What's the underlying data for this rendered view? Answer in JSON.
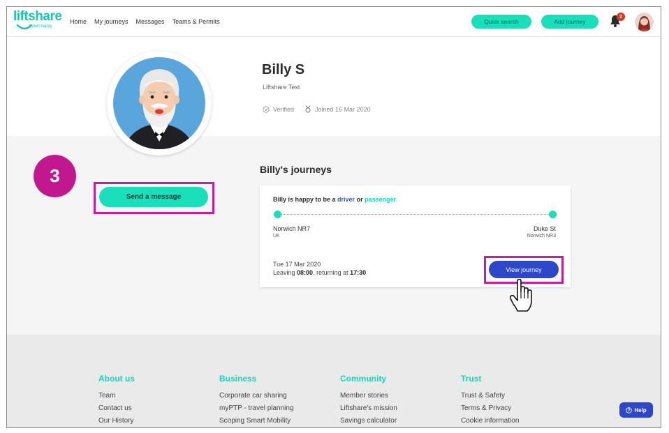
{
  "header": {
    "logo_text": "liftshare",
    "logo_tagline": "travel happy",
    "nav": [
      "Home",
      "My journeys",
      "Messages",
      "Teams & Permits"
    ],
    "quick_search_label": "Quick search",
    "add_journey_label": "Add journey",
    "notification_count": "2"
  },
  "profile": {
    "name": "Billy S",
    "subtitle": "Liftshare Test",
    "verified_label": "Verified",
    "joined_label": "Joined 16 Mar 2020"
  },
  "annotation": {
    "step_number": "3"
  },
  "actions": {
    "send_message_label": "Send a message"
  },
  "journeys": {
    "title": "Billy's journeys",
    "card": {
      "headline_prefix": "Billy is happy to be a",
      "role_driver": "driver",
      "role_connector": "or",
      "role_passenger": "passenger",
      "from_place": "Norwich NR7",
      "from_sub": "UK",
      "to_place": "Duke St",
      "to_sub": "Norwich NR3",
      "date": "Tue 17 Mar 2020",
      "leaving_prefix": "Leaving",
      "leaving_time": "08:00",
      "returning_prefix": ", returning at",
      "returning_time": "17:30",
      "view_label": "View journey"
    }
  },
  "footer": {
    "columns": [
      {
        "heading": "About us",
        "links": [
          "Team",
          "Contact us",
          "Our History"
        ]
      },
      {
        "heading": "Business",
        "links": [
          "Corporate car sharing",
          "myPTP - travel planning",
          "Scoping Smart Mobility"
        ]
      },
      {
        "heading": "Community",
        "links": [
          "Member stories",
          "Liftshare's mission",
          "Savings calculator"
        ]
      },
      {
        "heading": "Trust",
        "links": [
          "Trust & Safety",
          "Terms & Privacy",
          "Cookie information"
        ]
      }
    ],
    "help_label": "Help"
  },
  "colors": {
    "brand_teal": "#19e0bb",
    "brand_blue": "#2e47c9",
    "highlight_magenta": "#c61da0",
    "badge_red": "#d9371d"
  }
}
